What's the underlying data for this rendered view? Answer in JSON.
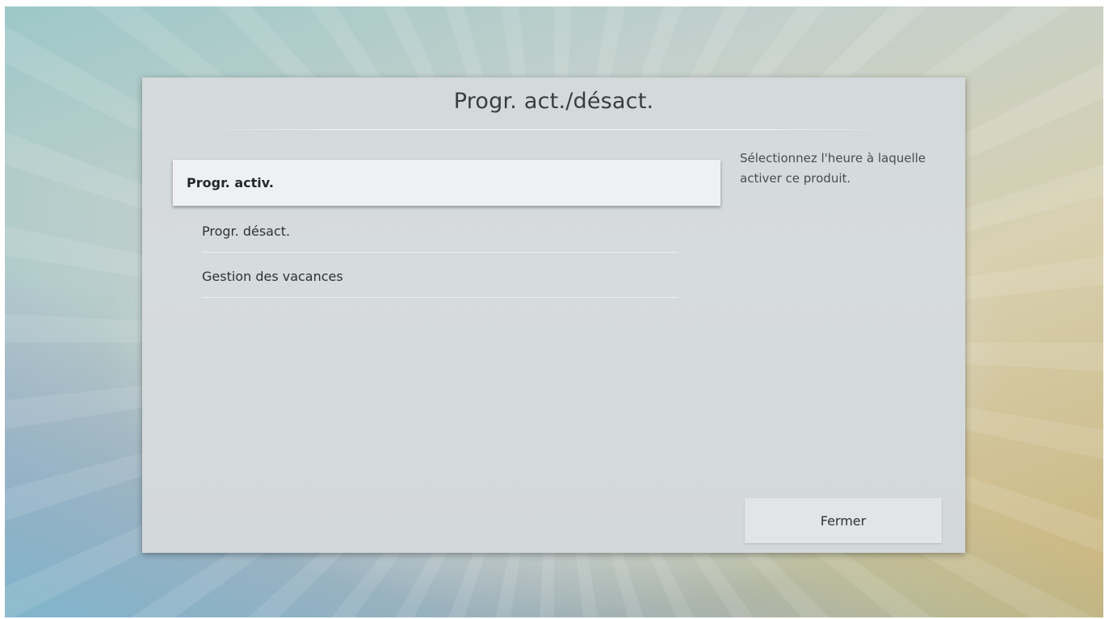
{
  "dialog": {
    "title": "Progr. act./désact.",
    "menu_items": [
      {
        "label": "Progr. activ.",
        "focused": true
      },
      {
        "label": "Progr. désact.",
        "focused": false
      },
      {
        "label": "Gestion des vacances",
        "focused": false
      }
    ],
    "help_text": "Sélectionnez l'heure à laquelle activer ce produit.",
    "close_label": "Fermer"
  }
}
